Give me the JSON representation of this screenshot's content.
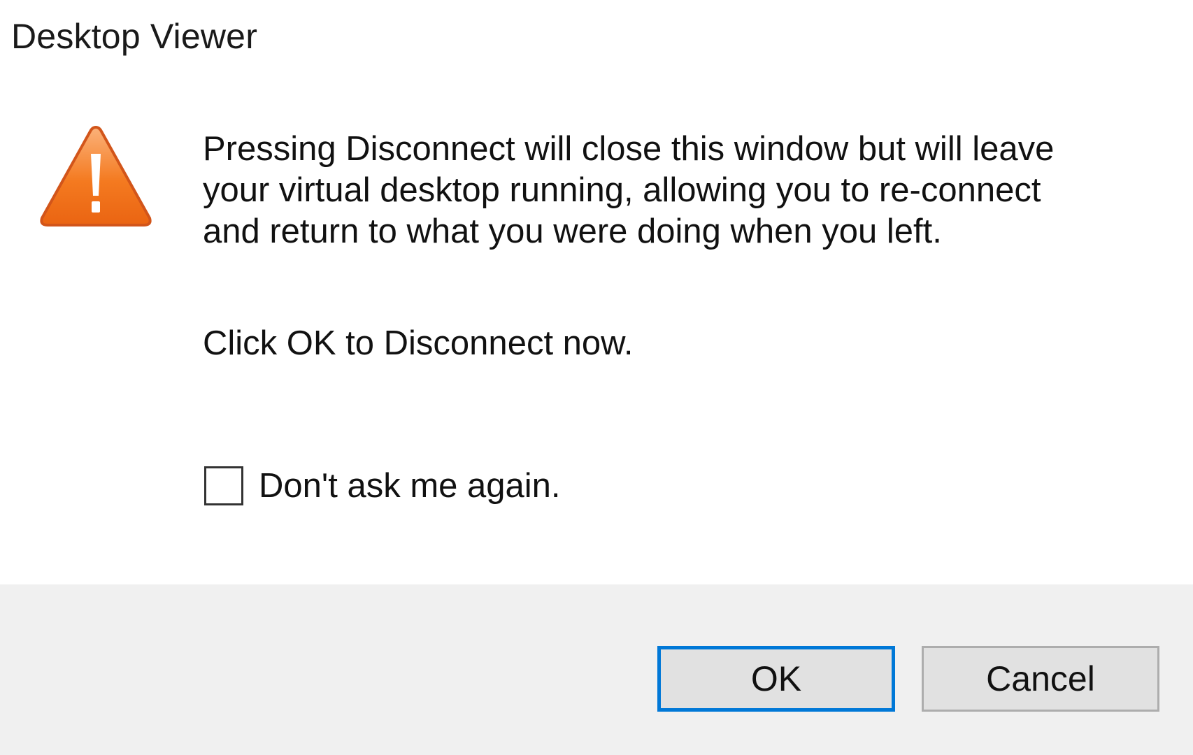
{
  "window": {
    "title": "Desktop Viewer"
  },
  "icon": {
    "name": "warning-icon",
    "color": "#f47a20"
  },
  "message": {
    "lines": [
      "Pressing Disconnect will close this window but will leave",
      "your virtual desktop running, allowing you to re-connect",
      "and return to what you were doing when you left."
    ],
    "prompt": "Click OK to Disconnect now."
  },
  "checkbox": {
    "label": "Don't ask me again.",
    "checked": false
  },
  "buttons": {
    "ok_label": "OK",
    "cancel_label": "Cancel"
  },
  "colors": {
    "accent": "#0078d7",
    "footer_bg": "#f0f0f0",
    "button_bg": "#e1e1e1"
  }
}
